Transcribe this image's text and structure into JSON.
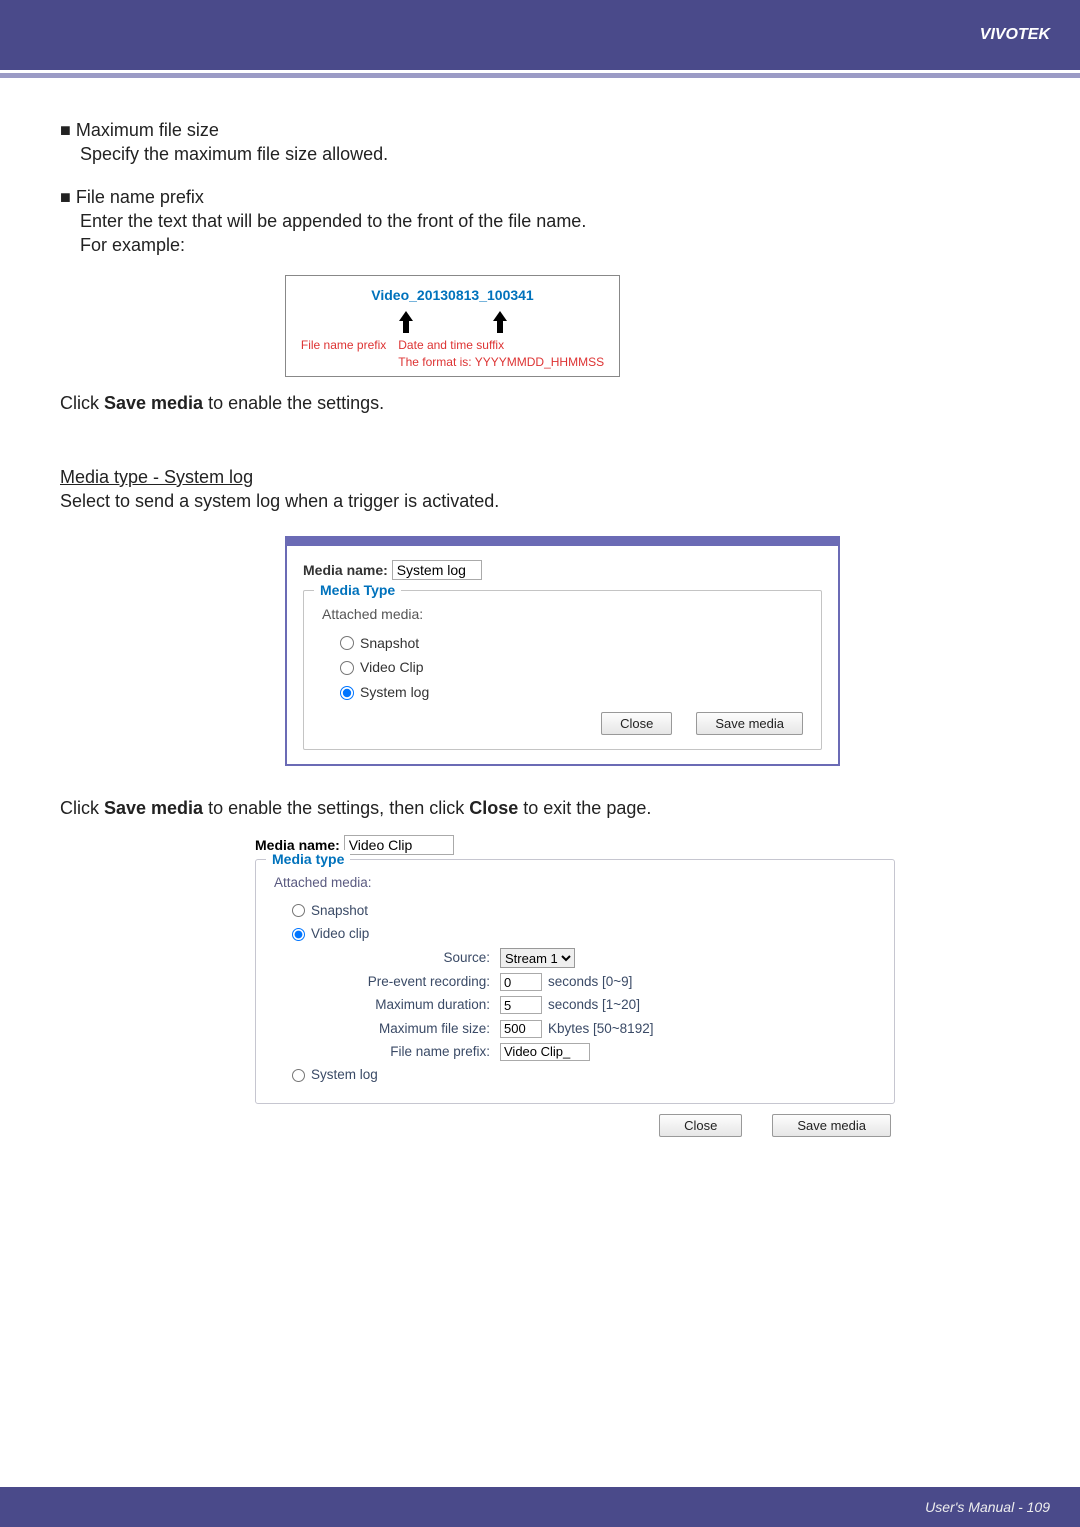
{
  "header": {
    "brand": "VIVOTEK"
  },
  "section1": {
    "bullet1_title": "■ Maximum file size",
    "bullet1_desc": "Specify the maximum file size allowed.",
    "bullet2_title": "■ File name prefix",
    "bullet2_desc": "Enter the text that will be appended to the front of the file name.",
    "bullet2_example_lead": "For example:",
    "example": {
      "filename": "Video_20130813_100341",
      "prefix_label": "File name prefix",
      "suffix_label_1": "Date and time suffix",
      "suffix_label_2": "The format is: YYYYMMDD_HHMMSS"
    },
    "after_example_1a": "Click ",
    "after_example_1b": "Save media",
    "after_example_1c": " to enable the settings."
  },
  "section2": {
    "heading": "Media type - System log",
    "line": "Select to send a system log when a trigger is activated.",
    "dialog": {
      "media_name_label": "Media name:",
      "media_name_value": "System log",
      "legend": "Media Type",
      "attached_label": "Attached media:",
      "opt_snapshot": "Snapshot",
      "opt_videoclip": "Video Clip",
      "opt_systemlog": "System log",
      "btn_close": "Close",
      "btn_save": "Save media"
    },
    "after_1a": "Click ",
    "after_1b": "Save media",
    "after_1c": " to enable the settings, then click ",
    "after_1d": "Close",
    "after_1e": " to exit the page."
  },
  "dialog2": {
    "media_name_label": "Media name:",
    "media_name_value": "Video Clip",
    "legend": "Media type",
    "attached_label": "Attached media:",
    "opt_snapshot": "Snapshot",
    "opt_videoclip": "Video clip",
    "source_label": "Source:",
    "source_value": "Stream 1",
    "preevent_label": "Pre-event recording:",
    "preevent_value": "0",
    "preevent_hint": "seconds [0~9]",
    "maxdur_label": "Maximum duration:",
    "maxdur_value": "5",
    "maxdur_hint": "seconds [1~20]",
    "maxsize_label": "Maximum file size:",
    "maxsize_value": "500",
    "maxsize_hint": "Kbytes [50~8192]",
    "prefix_label": "File name prefix:",
    "prefix_value": "Video Clip_",
    "opt_systemlog": "System log",
    "btn_close": "Close",
    "btn_save": "Save media"
  },
  "footer": {
    "text": "User's Manual - 109"
  }
}
